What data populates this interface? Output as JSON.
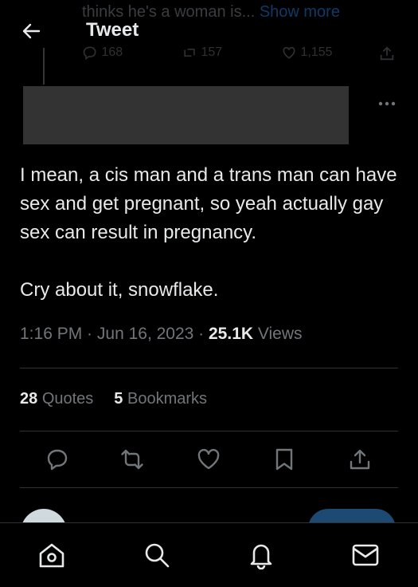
{
  "previous_tweet": {
    "text": "thinks he's a woman is...",
    "show_more": "Show more",
    "replies": "168",
    "retweets": "157",
    "likes": "1,155"
  },
  "header": {
    "title": "Tweet"
  },
  "tweet": {
    "paragraph1": "I mean, a cis man and a trans man can have sex and get pregnant, so yeah actually gay sex can result in pregnancy.",
    "paragraph2": "Cry about it, snowflake.",
    "time": "1:16 PM",
    "date": "Jun 16, 2023",
    "views_count": "25.1K",
    "views_label": "Views",
    "quotes_count": "28",
    "quotes_label": "Quotes",
    "bookmarks_count": "5",
    "bookmarks_label": "Bookmarks"
  },
  "colors": {
    "background": "#000000",
    "text": "#e7e9ea",
    "muted": "#71767b",
    "divider": "#2f3336"
  },
  "icons": {
    "actions": [
      "reply-icon",
      "retweet-icon",
      "like-icon",
      "bookmark-icon",
      "share-icon"
    ],
    "nav": [
      "home-icon",
      "search-icon",
      "notifications-icon",
      "messages-icon"
    ]
  }
}
